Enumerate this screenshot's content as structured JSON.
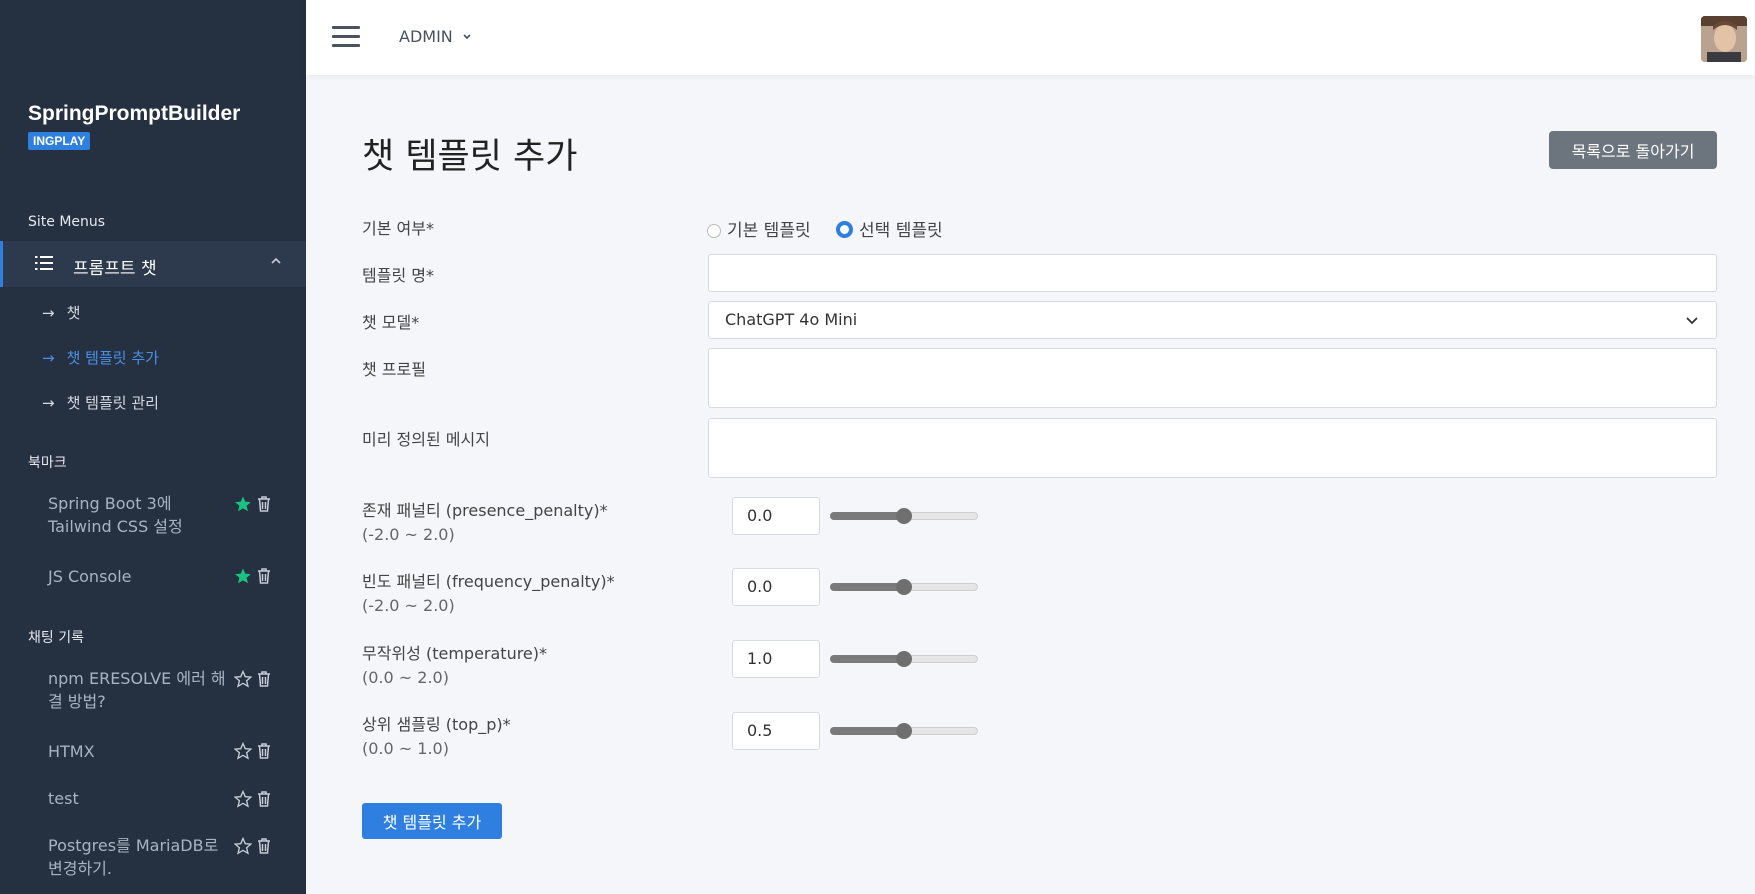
{
  "brand": {
    "name": "SpringPromptBuilder",
    "badge": "INGPLAY"
  },
  "sidebar": {
    "site_menus_title": "Site Menus",
    "active_menu": "프롬프트 챗",
    "sub_items": [
      {
        "label": "챗",
        "active": false
      },
      {
        "label": "챗 템플릿 추가",
        "active": true
      },
      {
        "label": "챗 템플릿 관리",
        "active": false
      }
    ],
    "bookmarks_title": "북마크",
    "bookmarks": [
      {
        "label": "Spring Boot 3에 Tailwind CSS 설정",
        "starred": true
      },
      {
        "label": "JS Console",
        "starred": true
      }
    ],
    "chat_history_title": "채팅 기록",
    "chat_history": [
      {
        "label": "npm ERESOLVE 에러 해결 방법?",
        "starred": false
      },
      {
        "label": "HTMX",
        "starred": false
      },
      {
        "label": "test",
        "starred": false
      },
      {
        "label": "Postgres를 MariaDB로 변경하기.",
        "starred": false
      }
    ]
  },
  "topbar": {
    "user_menu": "ADMIN"
  },
  "page": {
    "title": "챗 템플릿 추가",
    "back_button": "목록으로 돌아가기",
    "submit_button": "챗 템플릿 추가"
  },
  "form": {
    "default_label": "기본 여부*",
    "radio_options": [
      {
        "label": "기본 템플릿",
        "checked": false
      },
      {
        "label": "선택 템플릿",
        "checked": true
      }
    ],
    "template_name_label": "템플릿 명*",
    "template_name_value": "",
    "model_label": "챗 모델*",
    "model_value": "ChatGPT 4o Mini",
    "profile_label": "챗 프로필",
    "profile_value": "",
    "predefined_label": "미리 정의된 메시지",
    "predefined_value": "",
    "params": [
      {
        "label": "존재 패널티 (presence_penalty)*",
        "range": "(-2.0 ~ 2.0)",
        "value": "0.0",
        "slider_fraction": 0.5
      },
      {
        "label": "빈도 패널티 (frequency_penalty)*",
        "range": "(-2.0 ~ 2.0)",
        "value": "0.0",
        "slider_fraction": 0.5
      },
      {
        "label": "무작위성 (temperature)*",
        "range": "(0.0 ~ 2.0)",
        "value": "1.0",
        "slider_fraction": 0.5
      },
      {
        "label": "상위 샘플링 (top_p)*",
        "range": "(0.0 ~ 1.0)",
        "value": "0.5",
        "slider_fraction": 0.5
      }
    ]
  },
  "colors": {
    "sidebar_bg": "#253041",
    "accent": "#2f7fe0",
    "star_filled": "#19c37d"
  }
}
